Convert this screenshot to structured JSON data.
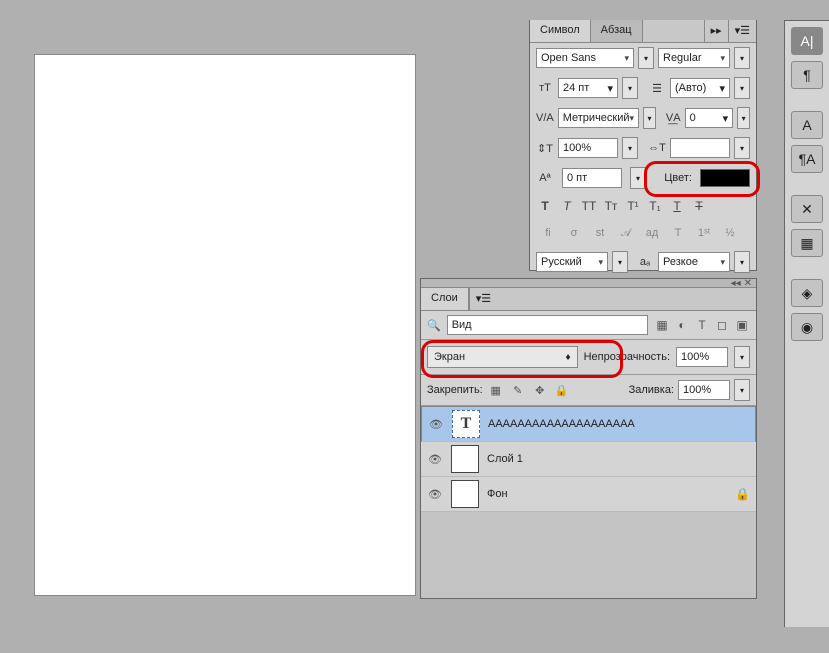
{
  "char_panel": {
    "tab_symbol": "Символ",
    "tab_paragraph": "Абзац",
    "font_family": "Open Sans",
    "font_style": "Regular",
    "font_size": "24 пт",
    "leading": "(Авто)",
    "kerning": "Метрический",
    "tracking": "0",
    "vscale": "100%",
    "hscale": "",
    "baseline": "0 пт",
    "color_label": "Цвет:",
    "lang": "Русский",
    "aa": "Резкое"
  },
  "layers": {
    "tab": "Слои",
    "search": "Вид",
    "blend_mode": "Экран",
    "opacity_label": "Непрозрачность:",
    "opacity": "100%",
    "lock_label": "Закрепить:",
    "fill_label": "Заливка:",
    "fill": "100%",
    "items": [
      {
        "label": "AAAAAAAAAAAAAAAAAAAA",
        "type": "type",
        "selected": true,
        "lock": false
      },
      {
        "label": "Слой 1",
        "type": "pixel",
        "selected": false,
        "lock": false
      },
      {
        "label": "Фон",
        "type": "pixel",
        "selected": false,
        "lock": true
      }
    ]
  }
}
